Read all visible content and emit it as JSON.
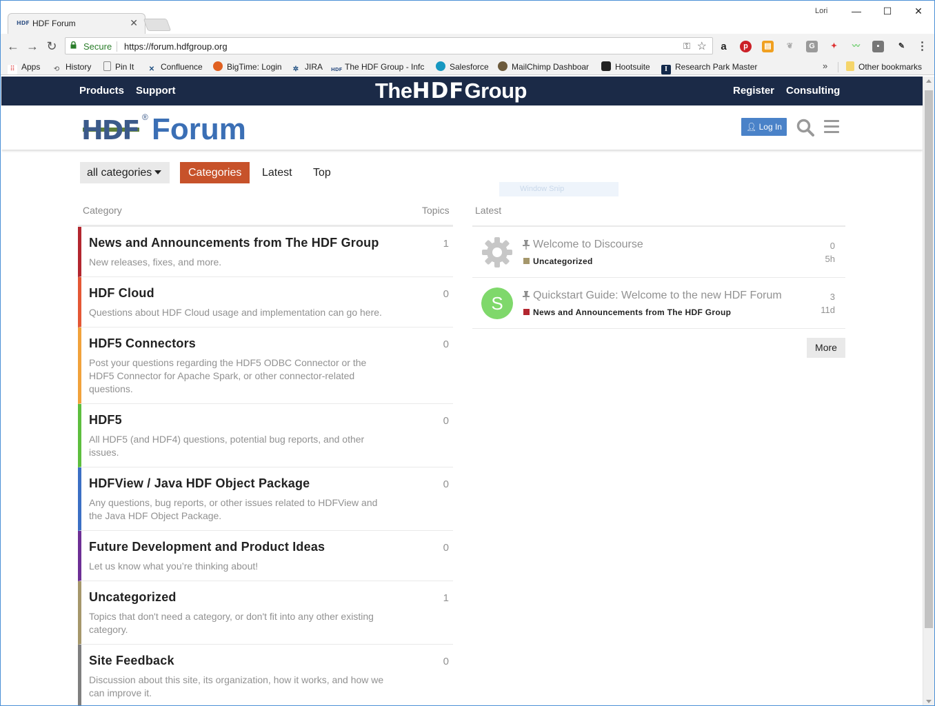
{
  "browser": {
    "tab_title": "HDF Forum",
    "tab_favicon": "HDF",
    "user_label": "Lori",
    "omnibox_secure": "Secure",
    "omnibox_url": "https://forum.hdfgroup.org",
    "bookmarks": [
      {
        "label": "Apps",
        "icon": "apps-grid-icon"
      },
      {
        "label": "History",
        "icon": "history-icon"
      },
      {
        "label": "Pin It",
        "icon": "page-icon"
      },
      {
        "label": "Confluence",
        "icon": "confluence-icon"
      },
      {
        "label": "BigTime: Login",
        "icon": "bigtime-icon"
      },
      {
        "label": "JIRA",
        "icon": "jira-icon"
      },
      {
        "label": "The HDF Group - Infc",
        "icon": "hdf-icon"
      },
      {
        "label": "Salesforce",
        "icon": "salesforce-cloud-icon"
      },
      {
        "label": "MailChimp Dashboar",
        "icon": "mailchimp-icon"
      },
      {
        "label": "Hootsuite",
        "icon": "hootsuite-owl-icon"
      },
      {
        "label": "Research Park Master",
        "icon": "university-icon"
      }
    ],
    "bookmarks_overflow": "»",
    "other_bookmarks": "Other bookmarks"
  },
  "site_nav": {
    "left": [
      "Products",
      "Support"
    ],
    "brand_prefix": "The",
    "brand_mid": "HDF",
    "brand_suffix": "Group",
    "right": [
      "Register",
      "Consulting"
    ]
  },
  "header": {
    "logo_mark": "HDF",
    "logo_reg": "®",
    "logo_word": "Forum",
    "login_label": "Log In"
  },
  "filters": {
    "dropdown_label": "all categories",
    "tabs": [
      "Categories",
      "Latest",
      "Top"
    ]
  },
  "snip_overlay": "Window Snip",
  "columns": {
    "category": "Category",
    "topics": "Topics",
    "latest": "Latest"
  },
  "categories": [
    {
      "name": "News and Announcements from The HDF Group",
      "description": "New releases, fixes, and more.",
      "topics": "1",
      "color": "#b3262f"
    },
    {
      "name": "HDF Cloud",
      "description": "Questions about HDF Cloud usage and implementation can go here.",
      "topics": "0",
      "color": "#e45735"
    },
    {
      "name": "HDF5 Connectors",
      "description": "Post your questions regarding the HDF5 ODBC Connector or the HDF5 Connector for Apache Spark, or other connector-related questions.",
      "topics": "0",
      "color": "#f1a23b"
    },
    {
      "name": "HDF5",
      "description": "All HDF5 (and HDF4) questions, potential bug reports, and other issues.",
      "topics": "0",
      "color": "#5dbe3e"
    },
    {
      "name": "HDFView / Java HDF Object Package",
      "description": "Any questions, bug reports, or other issues related to HDFView and the Java HDF Object Package.",
      "topics": "0",
      "color": "#3b6fc4"
    },
    {
      "name": "Future Development and Product Ideas",
      "description": "Let us know what you’re thinking about!",
      "topics": "0",
      "color": "#6d2f95"
    },
    {
      "name": "Uncategorized",
      "description": "Topics that don't need a category, or don't fit into any other existing category.",
      "topics": "1",
      "color": "#a5976b"
    },
    {
      "name": "Site Feedback",
      "description": "Discussion about this site, its organization, how it works, and how we can improve it.",
      "topics": "0",
      "color": "#7f7f7f"
    }
  ],
  "latest": [
    {
      "title": "Welcome to Discourse",
      "category": "Uncategorized",
      "category_color": "#a5976b",
      "replies": "0",
      "age": "5h",
      "avatar": "gear-avatar-icon",
      "avatar_letter": ""
    },
    {
      "title": "Quickstart Guide: Welcome to the new HDF Forum",
      "category": "News and Announcements from The HDF Group",
      "category_color": "#b3262f",
      "replies": "3",
      "age": "11d",
      "avatar": "letter-avatar",
      "avatar_letter": "S"
    }
  ],
  "more_label": "More"
}
